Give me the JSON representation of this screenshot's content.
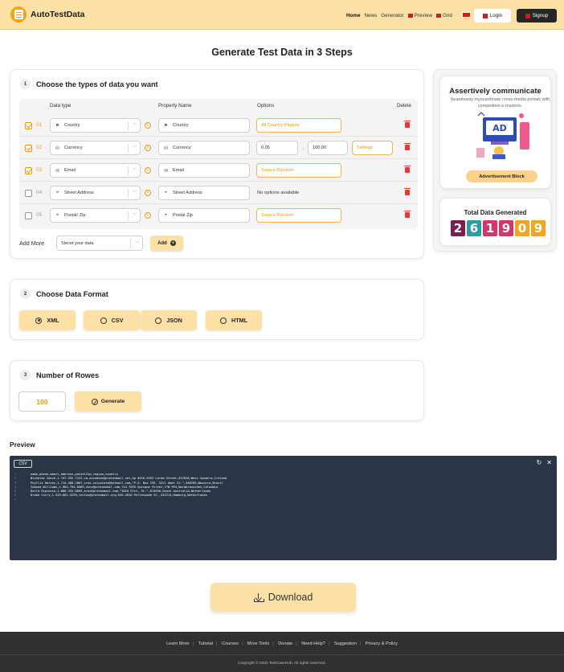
{
  "header": {
    "brand": "AutoTestData",
    "nav": [
      "Home",
      "News",
      "Generator",
      "Preview",
      "Grid"
    ],
    "login_label": "Login",
    "signup_label": "Signup"
  },
  "page_title": "Generate Test Data in 3 Steps",
  "step1": {
    "number": "1",
    "title": "Choose the types of data you want",
    "columns": [
      "Data type",
      "Property Name",
      "Options",
      "Delete"
    ],
    "rows": [
      {
        "checked": true,
        "index": "01",
        "icon": "flag-icon",
        "type": "Country",
        "property": "Country",
        "option_kind": "select",
        "option": "All Country Plugins"
      },
      {
        "checked": true,
        "index": "02",
        "icon": "currency-icon",
        "type": "Currency",
        "property": "Currency",
        "option_kind": "range",
        "min": "0.05",
        "max": "100.00",
        "settings": "Settings"
      },
      {
        "checked": true,
        "index": "03",
        "icon": "mail-icon",
        "type": "Email",
        "property": "Email",
        "option_kind": "select",
        "option": "Source Random"
      },
      {
        "checked": false,
        "index": "04",
        "icon": "location-icon",
        "type": "Street Address",
        "property": "Street Address",
        "option_kind": "text",
        "option": "No options available"
      },
      {
        "checked": false,
        "index": "05",
        "icon": "location-icon",
        "type": "Postal/ Zip",
        "property": "Postal Zip",
        "option_kind": "select",
        "option": "Source Random"
      }
    ],
    "add_more_label": "Add More",
    "add_select_placeholder": "Slecet your data",
    "add_button": "Add"
  },
  "step2": {
    "number": "2",
    "title": "Choose Data Format",
    "formats": [
      {
        "label": "XML",
        "selected": true
      },
      {
        "label": "CSV",
        "selected": false
      },
      {
        "label": "JSON",
        "selected": false
      },
      {
        "label": "HTML",
        "selected": false
      }
    ]
  },
  "step3": {
    "number": "3",
    "title": "Number of Rowes",
    "rows_value": "100",
    "generate_label": "Generate"
  },
  "sidebar": {
    "ad_title": "Assertively communicate",
    "ad_subtitle": "Seamlessly myocardinate cross-media portals with competitive e-markets.",
    "ad_badge": "AD",
    "ad_button": "Advertisement Block",
    "total_title": "Total Data Generated",
    "digits": [
      "2",
      "6",
      "1",
      "9",
      "0",
      "9"
    ],
    "digit_colors": [
      "#7a1f4f",
      "#2a9ea1",
      "#d8336a",
      "#d8336a",
      "#f2a61c",
      "#f2a61c"
    ]
  },
  "preview": {
    "title": "Preview",
    "format_tag": "CSV",
    "lines": [
      "name,phone,email,address,postalZip,region,country",
      "Nicholas Vance,1-747-592-7122,ca.accumsan@protonmail.net,Ap #316-5553 Lorem Street,837828,West Sumatra,Ireland",
      "Phyllis Harvey,1-714-480-2067,cras.vulputate@hotmail.com,\"P.O. Box 235, 5221 Amet St.\",468789,Navarra,Brazil",
      "Iakona Williams,1-984-794-8589,nunc@protonmail.com,714-7635 Quisque Street,Y7W 9P4,Nordbrauschen,Colombia",
      "Darla Espinosa,1-886-322-0695,eros@protonmail.com,\"5610 Elit, St.\",613636,South Australia,Netherlands",
      "Drake Curry,1-529-661-5239,lectus@protonmail.org,645-4910 Pellesuade St.,432214,Hamburg,Netherlands",
      ""
    ]
  },
  "download_label": "Download",
  "footer": {
    "links": [
      "Learn More",
      "Tutorial",
      "Courses",
      "More Tools",
      "Donate",
      "Need Help?",
      "Suggestion",
      "Privacy & Policy"
    ],
    "copyright": "Copyright © 2022 TestCaseHub. All rights reserved."
  }
}
